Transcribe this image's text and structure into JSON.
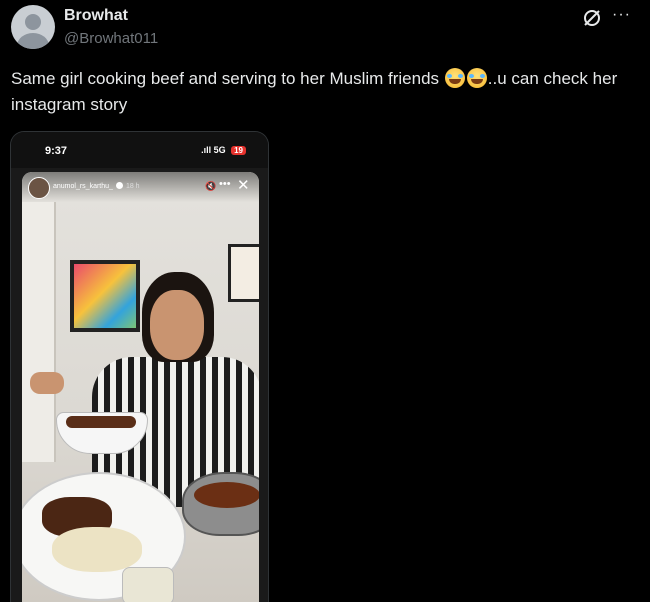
{
  "author": {
    "display_name": "Browhat",
    "handle": "@Browhat011"
  },
  "header_icons": {
    "grok": "grok-slash-icon",
    "more": "···"
  },
  "tweet": {
    "text_before": "Same girl cooking beef and serving to her Muslim friends ",
    "emojis": [
      "face-with-tears-of-joy",
      "face-with-tears-of-joy"
    ],
    "text_after": "..u can check her instagram story"
  },
  "media": {
    "phone_time": "9:37",
    "signal": ".ıll 5G",
    "battery": "19",
    "story": {
      "username": "anumol_rs_karthu_",
      "age": "18 h",
      "mute_icon": "muted-speaker-icon",
      "more": "•••",
      "close": "✕"
    }
  },
  "colors": {
    "background": "#000000",
    "text": "#e7e9ea",
    "muted": "#71767b"
  }
}
